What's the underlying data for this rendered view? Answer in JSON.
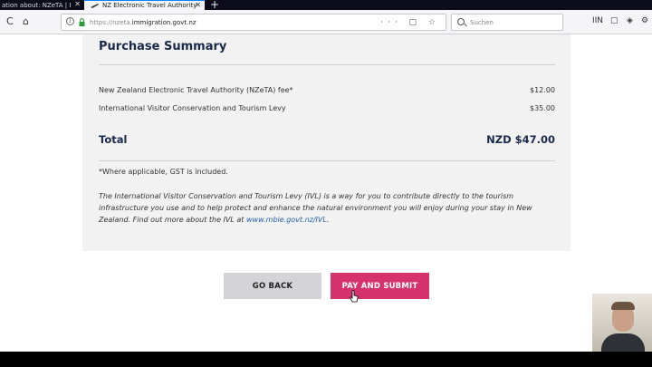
{
  "tabs": [
    {
      "title": "ation about: NZeTA | I",
      "active": false
    },
    {
      "title": "NZ Electronic Travel Authority",
      "active": true
    }
  ],
  "newtab_glyph": "+",
  "nav": {
    "back_glyph": "C",
    "home_glyph": "⌂",
    "url_prefix": "https://nzeta.",
    "url_domain": "immigration.govt.nz",
    "url_actions": "··· ▢ ☆",
    "search_placeholder": "Suchen",
    "right_icons": [
      "IIN",
      "▢",
      "◈",
      "⚙"
    ]
  },
  "summary": {
    "title": "Purchase Summary",
    "fees": [
      {
        "label": "New Zealand Electronic Travel Authority (NZeTA) fee*",
        "amount": "$12.00"
      },
      {
        "label": "International Visitor Conservation and Tourism Levy",
        "amount": "$35.00"
      }
    ],
    "total_label": "Total",
    "total_amount": "NZD $47.00",
    "gst_note": "*Where applicable, GST is included.",
    "ivl_note": "The International Visitor Conservation and Tourism Levy (IVL) is a way for you to contribute directly to the tourism infrastructure you use and to help protect and enhance the natural environment you will enjoy during your stay in New Zealand. Find out more about the IVL at",
    "ivl_link": "www.mbie.govt.nz/IVL",
    "ivl_link_suffix": "."
  },
  "buttons": {
    "back": "GO BACK",
    "submit": "PAY AND SUBMIT"
  },
  "colors": {
    "submit_bg": "#d6336c",
    "back_bg": "#d4d4d8",
    "title_color": "#1a2a4a",
    "link_color": "#1f5fa8",
    "tab_accent": "#0a84ff"
  },
  "icons": {
    "tab_favicon": "plane-icon",
    "url_info": "info-icon",
    "url_lock": "lock-icon",
    "search": "search-icon"
  }
}
